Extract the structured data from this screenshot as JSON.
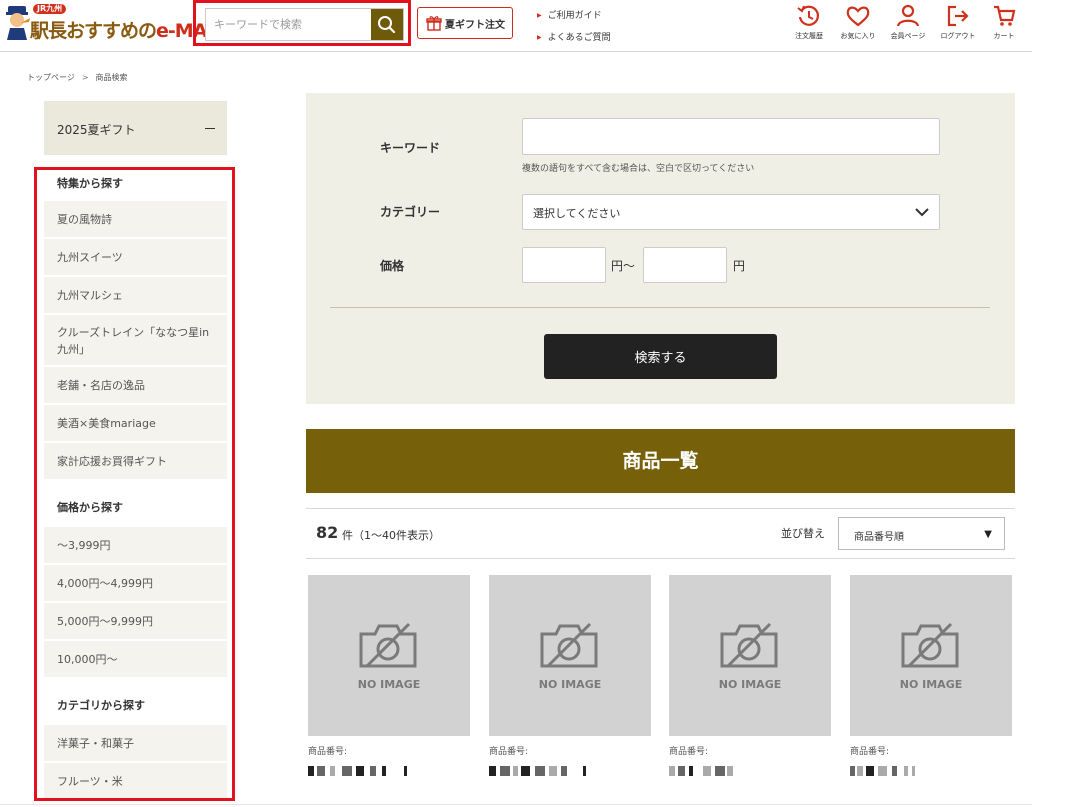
{
  "header": {
    "logo": {
      "badge": "JR九州",
      "text_part1": "駅長おすすめの",
      "text_part2": "e-MALL"
    },
    "search": {
      "placeholder": "キーワードで検索",
      "value": ""
    },
    "gift_button": "夏ギフト注文",
    "guide_links": [
      "ご利用ガイド",
      "よくあるご質問"
    ],
    "nav": [
      {
        "label": "注文履歴",
        "icon": "history-icon"
      },
      {
        "label": "お気に入り",
        "icon": "heart-icon"
      },
      {
        "label": "会員ページ",
        "icon": "user-icon"
      },
      {
        "label": "ログアウト",
        "icon": "logout-icon"
      },
      {
        "label": "カート",
        "icon": "cart-icon"
      }
    ]
  },
  "breadcrumb": {
    "items": [
      "トップページ",
      "商品検索"
    ],
    "separator": ">"
  },
  "sidebar": {
    "top_category": "2025夏ギフト",
    "sections": [
      {
        "title": "特集から探す",
        "items": [
          "夏の風物詩",
          "九州スイーツ",
          "九州マルシェ",
          "クルーズトレイン「ななつ星in九州」",
          "老舗・名店の逸品",
          "美酒×美食mariage",
          "家計応援お買得ギフト"
        ]
      },
      {
        "title": "価格から探す",
        "items": [
          "～3,999円",
          "4,000円～4,999円",
          "5,000円～9,999円",
          "10,000円～"
        ]
      },
      {
        "title": "カテゴリから探す",
        "items": [
          "洋菓子・和菓子",
          "フルーツ・米"
        ]
      }
    ]
  },
  "search_form": {
    "keyword_label": "キーワード",
    "keyword_value": "",
    "keyword_hint": "複数の語句をすべて含む場合は、空白で区切ってください",
    "category_label": "カテゴリー",
    "category_selected": "選択してください",
    "price_label": "価格",
    "price_min": "",
    "price_max": "",
    "yen_tilde": "円～",
    "yen": "円",
    "submit": "検索する"
  },
  "product_list": {
    "title": "商品一覧",
    "count": "82",
    "count_text": "件（1～40件表示）",
    "sort_label": "並び替え",
    "sort_selected": "商品番号順",
    "no_image_text": "NO IMAGE",
    "product_number_label": "商品番号:"
  },
  "colors": {
    "brand_olive": "#76600a",
    "search_button": "#6f5a0a",
    "highlight_red": "#e3101e",
    "panel_beige": "#f0efe6",
    "sidebar_item": "#f4f3ee",
    "submit_button": "#222222"
  }
}
